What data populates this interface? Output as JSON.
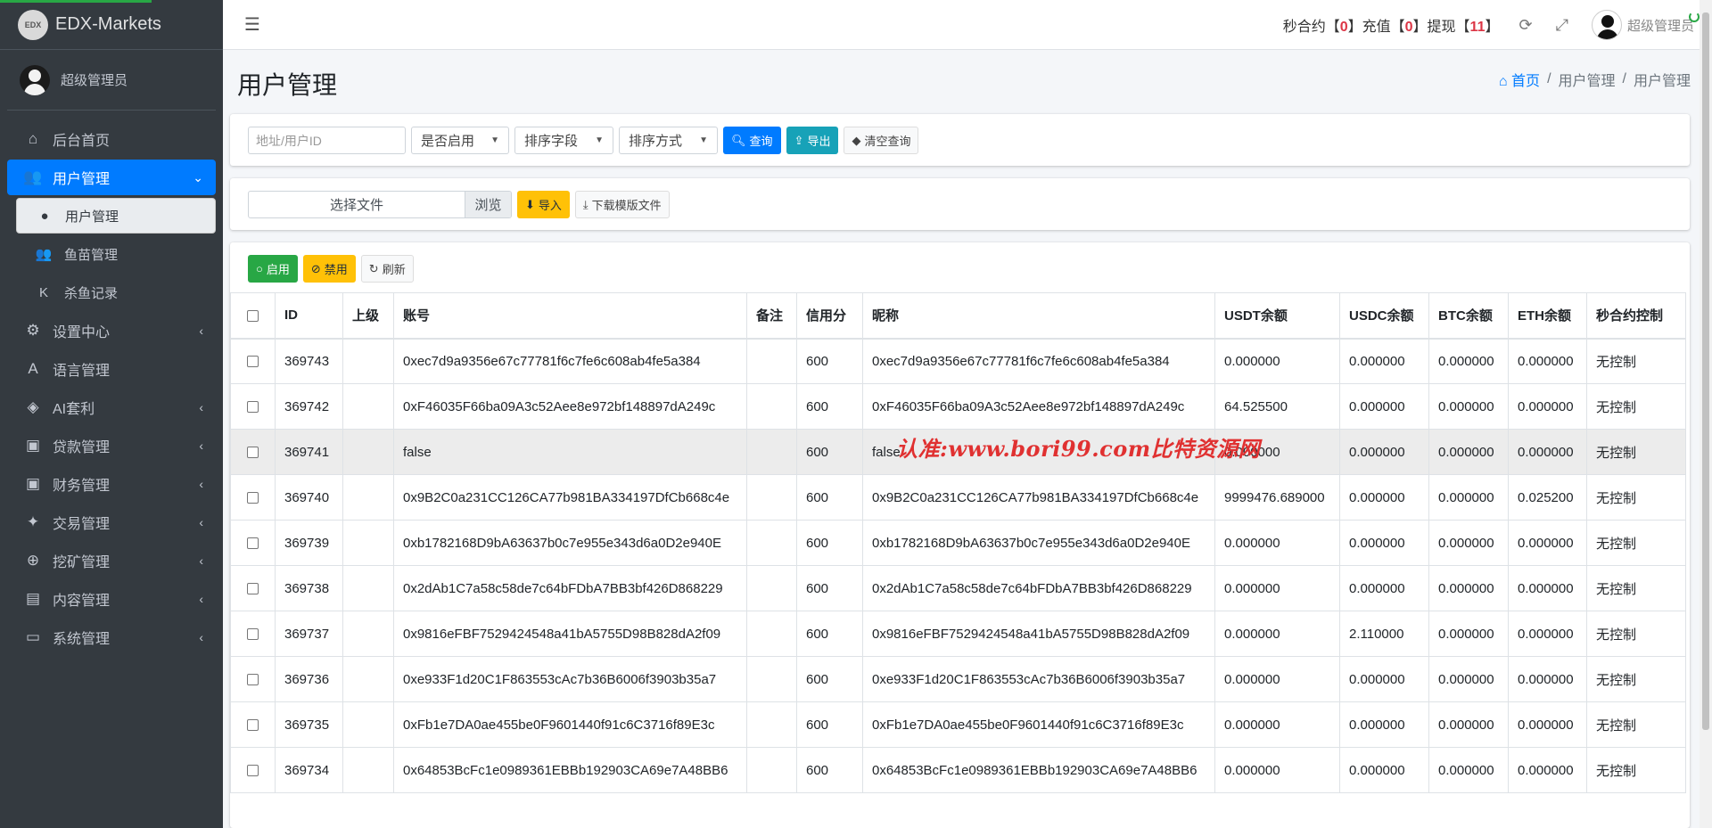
{
  "sidebar": {
    "brand": "EDX-Markets",
    "brand_logo": "EDX",
    "user": "超级管理员",
    "items": [
      {
        "label": "后台首页",
        "icon": "home-icon",
        "glyph": "⌂",
        "expandable": false
      },
      {
        "label": "用户管理",
        "icon": "users-icon",
        "glyph": "👥",
        "expandable": true,
        "active": true
      },
      {
        "label": "设置中心",
        "icon": "gears-icon",
        "glyph": "⚙",
        "expandable": true
      },
      {
        "label": "语言管理",
        "icon": "language-icon",
        "glyph": "A",
        "expandable": false
      },
      {
        "label": "AI套利",
        "icon": "android-icon",
        "glyph": "◈",
        "expandable": true
      },
      {
        "label": "贷款管理",
        "icon": "money-icon",
        "glyph": "▣",
        "expandable": true
      },
      {
        "label": "财务管理",
        "icon": "money-icon",
        "glyph": "▣",
        "expandable": true
      },
      {
        "label": "交易管理",
        "icon": "bitcoin-icon",
        "glyph": "✦",
        "expandable": true
      },
      {
        "label": "挖矿管理",
        "icon": "search-plus-icon",
        "glyph": "⊕",
        "expandable": true
      },
      {
        "label": "内容管理",
        "icon": "newspaper-icon",
        "glyph": "▤",
        "expandable": true
      },
      {
        "label": "系统管理",
        "icon": "desktop-icon",
        "glyph": "▭",
        "expandable": true
      }
    ],
    "subitems": [
      {
        "label": "用户管理",
        "icon": "user-icon",
        "glyph": "●",
        "active": true
      },
      {
        "label": "鱼苗管理",
        "icon": "users-icon",
        "glyph": "👥",
        "active": false
      },
      {
        "label": "杀鱼记录",
        "icon": "k-icon",
        "glyph": "K",
        "active": false
      }
    ]
  },
  "topbar": {
    "counters_prefix1": "秒合约【",
    "count1": "0",
    "counters_prefix2": "】充值【",
    "count2": "0",
    "counters_prefix3": "】提现【",
    "count3": "11",
    "counters_suffix": "】",
    "user": "超级管理员"
  },
  "page": {
    "title": "用户管理",
    "breadcrumb": [
      "首页",
      "用户管理",
      "用户管理"
    ]
  },
  "filters": {
    "search_placeholder": "地址/用户ID",
    "enabled_select": "是否启用",
    "sort_field_select": "排序字段",
    "sort_order_select": "排序方式",
    "query_label": "查询",
    "export_label": "导出",
    "clear_label": "清空查询"
  },
  "import": {
    "file_label": "选择文件",
    "browse_label": "浏览",
    "import_label": "导入",
    "download_template_label": "下载模版文件"
  },
  "toolbar": {
    "enable_label": "启用",
    "disable_label": "禁用",
    "refresh_label": "刷新"
  },
  "watermark": "认准:www.bori99.com比特资源网",
  "table": {
    "headers": [
      "ID",
      "上级",
      "账号",
      "备注",
      "信用分",
      "昵称",
      "USDT余额",
      "USDC余额",
      "BTC余额",
      "ETH余额",
      "秒合约控制"
    ],
    "rows": [
      [
        "369743",
        "",
        "0xec7d9a9356e67c77781f6c7fe6c608ab4fe5a384",
        "",
        "600",
        "0xec7d9a9356e67c77781f6c7fe6c608ab4fe5a384",
        "0.000000",
        "0.000000",
        "0.000000",
        "0.000000",
        "无控制"
      ],
      [
        "369742",
        "",
        "0xF46035F66ba09A3c52Aee8e972bf148897dA249c",
        "",
        "600",
        "0xF46035F66ba09A3c52Aee8e972bf148897dA249c",
        "64.525500",
        "0.000000",
        "0.000000",
        "0.000000",
        "无控制"
      ],
      [
        "369741",
        "",
        "false",
        "",
        "600",
        "false",
        "0.000000",
        "0.000000",
        "0.000000",
        "0.000000",
        "无控制"
      ],
      [
        "369740",
        "",
        "0x9B2C0a231CC126CA77b981BA334197DfCb668c4e",
        "",
        "600",
        "0x9B2C0a231CC126CA77b981BA334197DfCb668c4e",
        "9999476.689000",
        "0.000000",
        "0.000000",
        "0.025200",
        "无控制"
      ],
      [
        "369739",
        "",
        "0xb1782168D9bA63637b0c7e955e343d6a0D2e940E",
        "",
        "600",
        "0xb1782168D9bA63637b0c7e955e343d6a0D2e940E",
        "0.000000",
        "0.000000",
        "0.000000",
        "0.000000",
        "无控制"
      ],
      [
        "369738",
        "",
        "0x2dAb1C7a58c58de7c64bFDbA7BB3bf426D868229",
        "",
        "600",
        "0x2dAb1C7a58c58de7c64bFDbA7BB3bf426D868229",
        "0.000000",
        "0.000000",
        "0.000000",
        "0.000000",
        "无控制"
      ],
      [
        "369737",
        "",
        "0x9816eFBF7529424548a41bA5755D98B828dA2f09",
        "",
        "600",
        "0x9816eFBF7529424548a41bA5755D98B828dA2f09",
        "0.000000",
        "2.110000",
        "0.000000",
        "0.000000",
        "无控制"
      ],
      [
        "369736",
        "",
        "0xe933F1d20C1F863553cAc7b36B6006f3903b35a7",
        "",
        "600",
        "0xe933F1d20C1F863553cAc7b36B6006f3903b35a7",
        "0.000000",
        "0.000000",
        "0.000000",
        "0.000000",
        "无控制"
      ],
      [
        "369735",
        "",
        "0xFb1e7DA0ae455be0F9601440f91c6C3716f89E3c",
        "",
        "600",
        "0xFb1e7DA0ae455be0F9601440f91c6C3716f89E3c",
        "0.000000",
        "0.000000",
        "0.000000",
        "0.000000",
        "无控制"
      ],
      [
        "369734",
        "",
        "0x64853BcFc1e0989361EBBb192903CA69e7A48BB6",
        "",
        "600",
        "0x64853BcFc1e0989361EBBb192903CA69e7A48BB6",
        "0.000000",
        "0.000000",
        "0.000000",
        "0.000000",
        "无控制"
      ]
    ]
  }
}
